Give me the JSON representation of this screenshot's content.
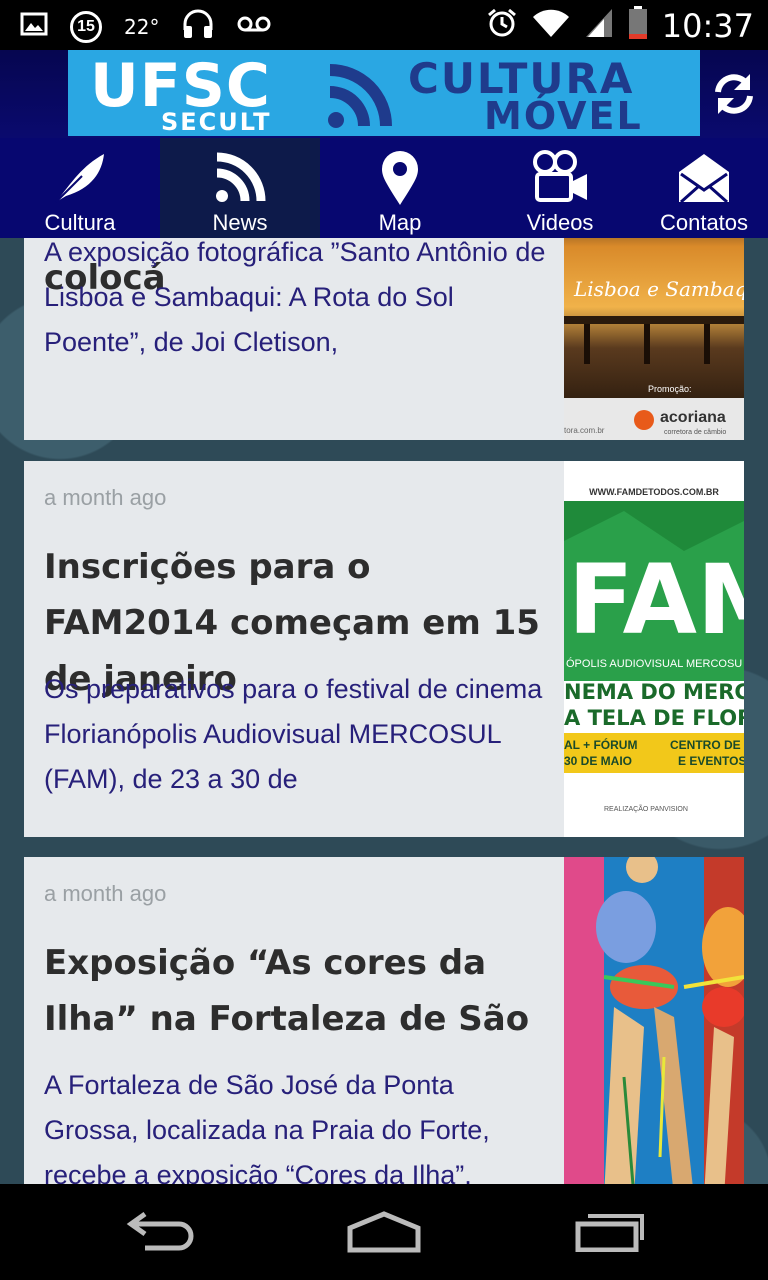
{
  "status_bar": {
    "badge": "15",
    "temperature": "22°",
    "time": "10:37"
  },
  "header": {
    "banner_left": "UFSC",
    "banner_sub": "SECULT",
    "banner_right_top": "CULTURA",
    "banner_right_bottom": "MÓVEL"
  },
  "tabs": [
    {
      "label": "Cultura",
      "icon": "feather-icon"
    },
    {
      "label": "News",
      "icon": "rss-icon",
      "active": true
    },
    {
      "label": "Map",
      "icon": "map-pin-icon"
    },
    {
      "label": "Videos",
      "icon": "video-camera-icon"
    },
    {
      "label": "Contatos",
      "icon": "envelope-icon"
    }
  ],
  "news": [
    {
      "title": "Rota do Sol Poente\" colocá",
      "description": "A exposição fotográfica ”Santo Antônio de Lisboa e Sambaqui: A Rota do Sol Poente”, de Joi Cletison,",
      "thumb_text": "Lisboa e Sambaqui",
      "thumb_sponsor": "acoriana",
      "thumb_sponsor_sub": "corretora de câmbio",
      "thumb_promo": "Promoção:",
      "thumb_url": "tora.com.br"
    },
    {
      "time": "a month ago",
      "title": "Inscrições para o FAM2014 começam em 15 de janeiro",
      "description": "Os preparativos para o festival de cinema Florianópolis Audiovisual MERCOSUL (FAM), de 23 a 30 de",
      "thumb_url": "WWW.FAMDETODOS.COM.BR",
      "thumb_big": "FAM",
      "thumb_line1": "ÓPOLIS AUDIOVISUAL MERCOSU",
      "thumb_line2": "NEMA DO MERCO",
      "thumb_line3": "A TELA DE FLORI",
      "thumb_line4": "AL + FÓRUM",
      "thumb_line5": "30 DE MAIO",
      "thumb_line6": "CENTRO DE C",
      "thumb_line7": "E EVENTOS",
      "thumb_footer": "REALIZAÇÃO  PANVISION"
    },
    {
      "time": "a month ago",
      "title": "Exposição “As cores da Ilha” na Fortaleza de São",
      "description": "A Fortaleza de São José da Ponta Grossa, localizada na Praia do Forte, recebe a exposição “Cores da Ilha”,"
    }
  ],
  "colors": {
    "header_bg": "#060650",
    "tab_bg": "#070770",
    "tab_active_bg": "#0d1a4a",
    "banner_bg": "#2aa7e3",
    "card_bg": "#e6e9ec",
    "desc_color": "#27207a"
  }
}
